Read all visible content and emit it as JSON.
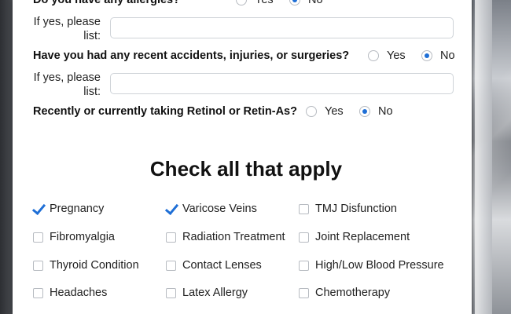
{
  "form": {
    "allergies": {
      "question": "Do you have any allergies?",
      "options": [
        {
          "label": "Yes",
          "selected": false
        },
        {
          "label": "No",
          "selected": true
        }
      ],
      "list_label": "If yes, please list:",
      "list_value": ""
    },
    "accidents": {
      "question": "Have you had any recent accidents, injuries, or surgeries?",
      "options": [
        {
          "label": "Yes",
          "selected": false
        },
        {
          "label": "No",
          "selected": true
        }
      ],
      "list_label": "If yes, please list:",
      "list_value": ""
    },
    "retinol": {
      "question": "Recently or currently taking Retinol or Retin-As?",
      "options": [
        {
          "label": "Yes",
          "selected": false
        },
        {
          "label": "No",
          "selected": true
        }
      ]
    },
    "checklist": {
      "title": "Check all that apply",
      "items": [
        {
          "label": "Pregnancy",
          "checked": true
        },
        {
          "label": "Varicose Veins",
          "checked": true
        },
        {
          "label": "TMJ Disfunction",
          "checked": false
        },
        {
          "label": "Fibromyalgia",
          "checked": false
        },
        {
          "label": "Radiation Treatment",
          "checked": false
        },
        {
          "label": "Joint Replacement",
          "checked": false
        },
        {
          "label": "Thyroid Condition",
          "checked": false
        },
        {
          "label": "Contact Lenses",
          "checked": false
        },
        {
          "label": "High/Low Blood Pressure",
          "checked": false
        },
        {
          "label": "Headaches",
          "checked": false
        },
        {
          "label": "Latex Allergy",
          "checked": false
        },
        {
          "label": "Chemotherapy",
          "checked": false
        }
      ]
    }
  }
}
